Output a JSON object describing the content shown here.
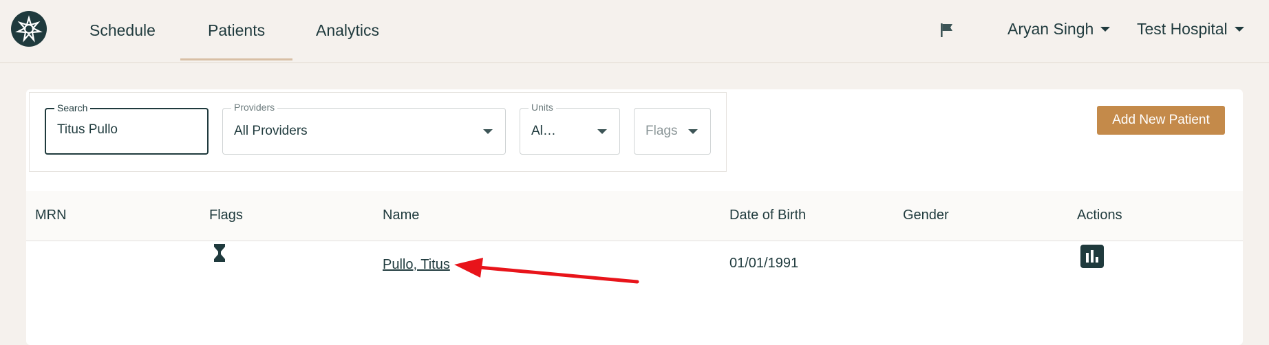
{
  "nav": {
    "tabs": [
      {
        "label": "Schedule"
      },
      {
        "label": "Patients",
        "active": true
      },
      {
        "label": "Analytics"
      }
    ],
    "user": "Aryan Singh",
    "hospital": "Test Hospital",
    "flag_icon": "flag-icon",
    "logo_icon": "star-logo-icon"
  },
  "filters": {
    "search": {
      "label": "Search",
      "value": "Titus Pullo"
    },
    "providers": {
      "label": "Providers",
      "value": "All Providers"
    },
    "units": {
      "label": "Units",
      "value": "Al…"
    },
    "flags": {
      "placeholder": "Flags"
    }
  },
  "add_button": "Add New Patient",
  "table": {
    "headers": [
      "MRN",
      "Flags",
      "Name",
      "Date of Birth",
      "Gender",
      "Actions"
    ],
    "rows": [
      {
        "mrn": "",
        "flag_icon": "hourglass-icon",
        "name": "Pullo, Titus",
        "dob": "01/01/1991",
        "gender": "",
        "action_icon": "analytics-chart-icon"
      }
    ]
  },
  "colors": {
    "brand_dark": "#1f3a3d",
    "accent": "#c48a4a",
    "annotation_arrow": "#e8141a",
    "background": "#f5f1ed"
  }
}
